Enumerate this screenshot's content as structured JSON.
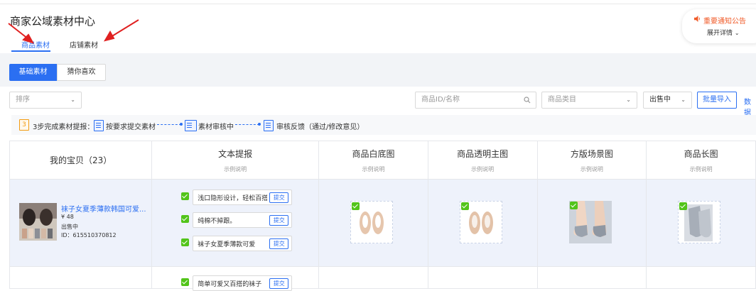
{
  "header": {
    "title": "商家公域素材中心",
    "tabs": [
      {
        "label": "商品素材",
        "active": true
      },
      {
        "label": "店铺素材",
        "active": false
      }
    ]
  },
  "notice": {
    "title": "重要通知公告",
    "expand": "展开详情"
  },
  "segment": {
    "items": [
      "基础素材",
      "猜你喜欢"
    ],
    "active": "基础素材"
  },
  "filters": {
    "sort_placeholder": "排序",
    "search_placeholder": "商品ID/名称",
    "category_placeholder": "商品类目",
    "status_value": "出售中",
    "import_button": "批量导入",
    "right_link": "数据"
  },
  "steps": {
    "lead": "3步完成素材提报：",
    "step1": "按要求提交素材",
    "step2": "素材审核中",
    "step3": "审核反馈（通过/修改意见）"
  },
  "table": {
    "columns": [
      {
        "title": "我的宝贝（23）",
        "sub": ""
      },
      {
        "title": "文本提报",
        "sub": "示例说明"
      },
      {
        "title": "商品白底图",
        "sub": "示例说明"
      },
      {
        "title": "商品透明主图",
        "sub": "示例说明"
      },
      {
        "title": "方版场景图",
        "sub": "示例说明"
      },
      {
        "title": "商品长图",
        "sub": "示例说明"
      }
    ],
    "rows": [
      {
        "product": {
          "name": "袜子女夏季薄款韩国可爱...",
          "price": "¥ 48",
          "status": "出售中",
          "id": "ID：615510370812"
        },
        "texts": [
          {
            "value": "浅口隐形设计，轻松百搭",
            "submit": "提交"
          },
          {
            "value": "纯棉不掉跟。",
            "submit": "提交"
          },
          {
            "value": "袜子女夏季薄款可爱",
            "submit": "提交"
          }
        ]
      },
      {
        "texts": [
          {
            "value": "简单可爱又百搭的袜子",
            "submit": "提交"
          }
        ]
      }
    ]
  },
  "colors": {
    "primary": "#2b6ff2",
    "notice": "#f05a28",
    "check": "#52c41a",
    "arrow": "#e02020"
  }
}
